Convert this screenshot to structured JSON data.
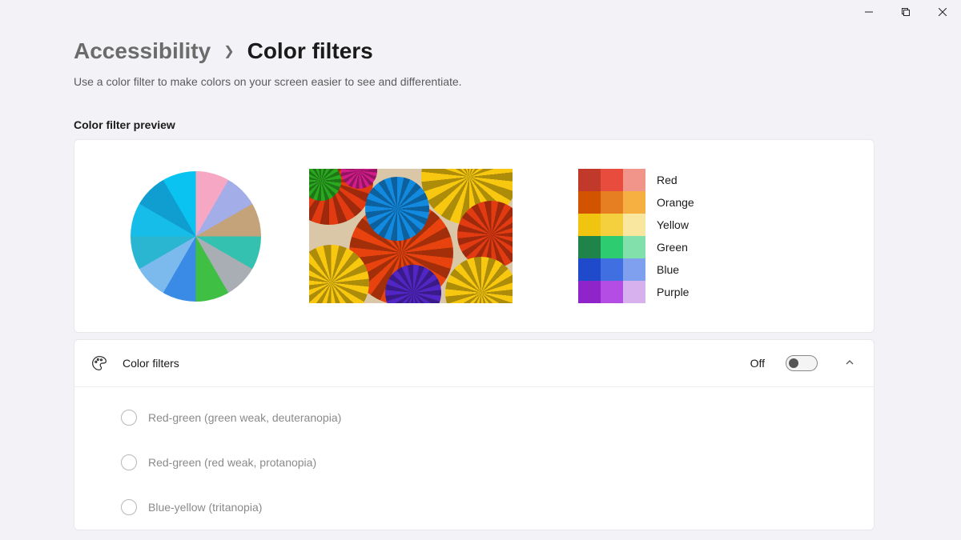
{
  "breadcrumb": {
    "parent": "Accessibility",
    "current": "Color filters"
  },
  "description": "Use a color filter to make colors on your screen easier to see and differentiate.",
  "preview": {
    "label": "Color filter preview",
    "swatches": [
      {
        "label": "Red",
        "c1": "#c0392b",
        "c2": "#e74c3c",
        "c3": "#f1948a"
      },
      {
        "label": "Orange",
        "c1": "#d35400",
        "c2": "#e67e22",
        "c3": "#f5b041"
      },
      {
        "label": "Yellow",
        "c1": "#f1c40f",
        "c2": "#f4d03f",
        "c3": "#f9e79f"
      },
      {
        "label": "Green",
        "c1": "#1e8449",
        "c2": "#2ecc71",
        "c3": "#82e0aa"
      },
      {
        "label": "Blue",
        "c1": "#1f4acc",
        "c2": "#3f6fe0",
        "c3": "#7ea0ef"
      },
      {
        "label": "Purple",
        "c1": "#8e24c9",
        "c2": "#b44de3",
        "c3": "#d7b0ee"
      }
    ]
  },
  "toggle": {
    "title": "Color filters",
    "state": "Off"
  },
  "options": [
    {
      "label": "Red-green (green weak, deuteranopia)"
    },
    {
      "label": "Red-green (red weak, protanopia)"
    },
    {
      "label": "Blue-yellow (tritanopia)"
    }
  ]
}
